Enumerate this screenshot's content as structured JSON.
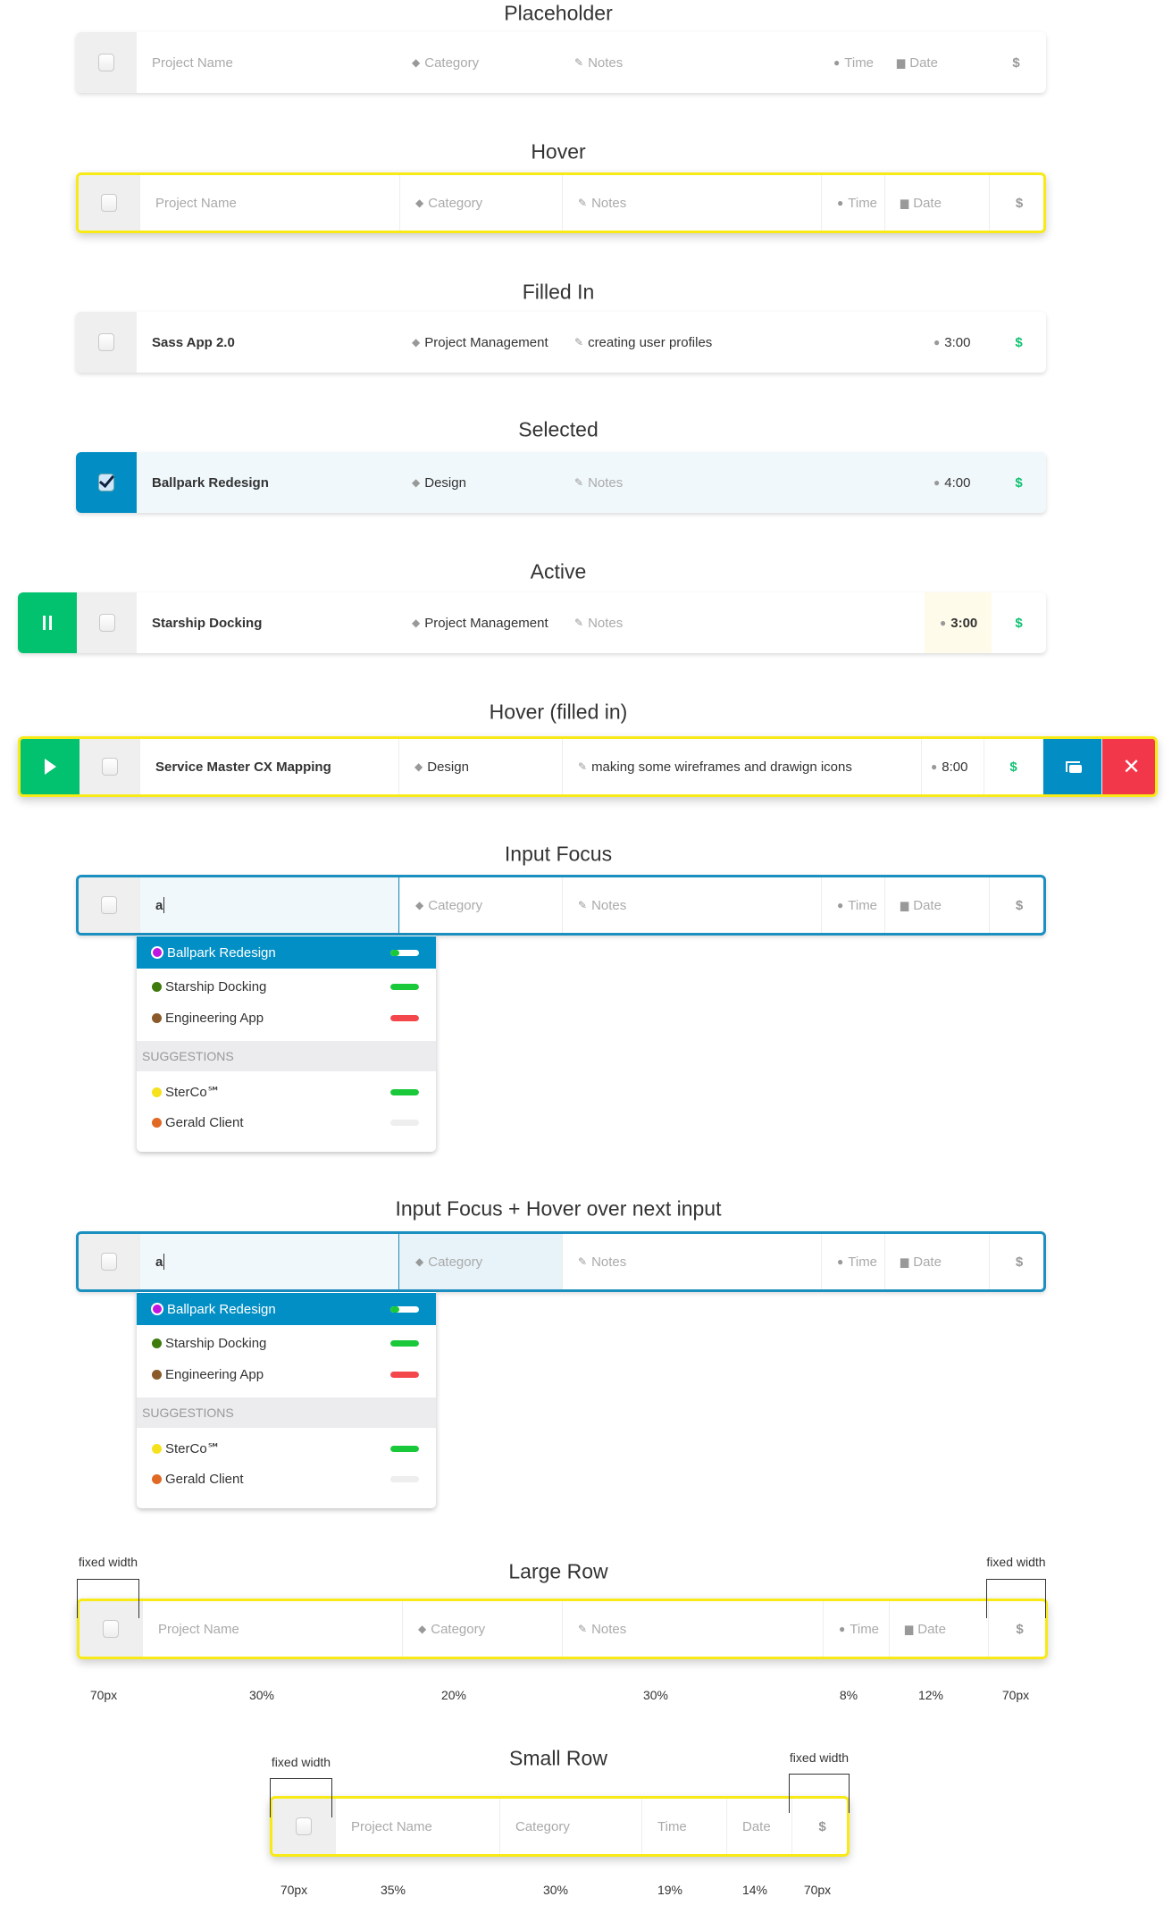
{
  "colors": {
    "accent_blue": "#028ec4",
    "play_green": "#02c16f",
    "delete_red": "#f3374b",
    "hover_yellow": "#f7ea17",
    "money_green": "#12c172"
  },
  "sections": [
    {
      "title": "Placeholder",
      "cells": [
        {
          "kind": "checkbox"
        },
        {
          "kind": "name",
          "text": "Project Name",
          "ph": true
        },
        {
          "kind": "category",
          "text": "Category",
          "ph": true
        },
        {
          "kind": "notes",
          "text": "Notes",
          "ph": true
        },
        {
          "kind": "time",
          "text": "Time",
          "ph": true
        },
        {
          "kind": "date",
          "text": "Date",
          "ph": true
        },
        {
          "kind": "money",
          "text": "$",
          "ph": true
        }
      ]
    },
    {
      "title": "Hover",
      "cells": [
        {
          "kind": "checkbox"
        },
        {
          "kind": "name",
          "text": "Project Name",
          "ph": true
        },
        {
          "kind": "category",
          "text": "Category",
          "ph": true
        },
        {
          "kind": "notes",
          "text": "Notes",
          "ph": true
        },
        {
          "kind": "time",
          "text": "Time",
          "ph": true
        },
        {
          "kind": "date",
          "text": "Date",
          "ph": true
        },
        {
          "kind": "money",
          "text": "$",
          "ph": true
        }
      ]
    },
    {
      "title": "Filled In",
      "cells": [
        {
          "kind": "checkbox"
        },
        {
          "kind": "name",
          "text": "Sass App 2.0"
        },
        {
          "kind": "category",
          "text": "Project Management"
        },
        {
          "kind": "notes",
          "text": "creating user profiles"
        },
        {
          "kind": "time",
          "text": "3:00"
        },
        {
          "kind": "money",
          "text": "$"
        }
      ]
    },
    {
      "title": "Selected",
      "cells": [
        {
          "kind": "checkbox",
          "checked": true
        },
        {
          "kind": "name",
          "text": "Ballpark Redesign"
        },
        {
          "kind": "category",
          "text": "Design"
        },
        {
          "kind": "notes",
          "text": "Notes",
          "ph": true
        },
        {
          "kind": "time",
          "text": "4:00"
        },
        {
          "kind": "money",
          "text": "$"
        }
      ]
    },
    {
      "title": "Active",
      "cells": [
        {
          "kind": "pause"
        },
        {
          "kind": "checkbox"
        },
        {
          "kind": "name",
          "text": "Starship Docking"
        },
        {
          "kind": "category",
          "text": "Project Management"
        },
        {
          "kind": "notes",
          "text": "Notes",
          "ph": true
        },
        {
          "kind": "time",
          "text": "3:00",
          "highlight": true
        },
        {
          "kind": "money",
          "text": "$"
        }
      ]
    },
    {
      "title": "Hover (filled in)",
      "cells": [
        {
          "kind": "play"
        },
        {
          "kind": "checkbox"
        },
        {
          "kind": "name",
          "text": "Service Master CX Mapping"
        },
        {
          "kind": "category",
          "text": "Design"
        },
        {
          "kind": "notes",
          "text": "making some wireframes and drawign icons"
        },
        {
          "kind": "time",
          "text": "8:00"
        },
        {
          "kind": "money",
          "text": "$"
        },
        {
          "kind": "copy"
        },
        {
          "kind": "delete"
        }
      ]
    },
    {
      "title": "Input Focus",
      "cells": [
        {
          "kind": "checkbox"
        },
        {
          "kind": "name",
          "text": "a",
          "input": true
        },
        {
          "kind": "category",
          "text": "Category",
          "ph": true
        },
        {
          "kind": "notes",
          "text": "Notes",
          "ph": true
        },
        {
          "kind": "time",
          "text": "Time",
          "ph": true
        },
        {
          "kind": "date",
          "text": "Date",
          "ph": true
        },
        {
          "kind": "money",
          "text": "$",
          "ph": true
        }
      ]
    },
    {
      "title": "Input Focus + Hover over next input",
      "cells": [
        {
          "kind": "checkbox"
        },
        {
          "kind": "name",
          "text": "a",
          "input": true
        },
        {
          "kind": "category",
          "text": "Category",
          "ph": true,
          "hover": true
        },
        {
          "kind": "notes",
          "text": "Notes",
          "ph": true
        },
        {
          "kind": "time",
          "text": "Time",
          "ph": true
        },
        {
          "kind": "date",
          "text": "Date",
          "ph": true
        },
        {
          "kind": "money",
          "text": "$",
          "ph": true
        }
      ]
    },
    {
      "title": "Large Row",
      "cells": [
        {
          "kind": "checkbox"
        },
        {
          "kind": "name",
          "text": "Project Name",
          "ph": true
        },
        {
          "kind": "category",
          "text": "Category",
          "ph": true
        },
        {
          "kind": "notes",
          "text": "Notes",
          "ph": true
        },
        {
          "kind": "time",
          "text": "Time",
          "ph": true
        },
        {
          "kind": "date",
          "text": "Date",
          "ph": true
        },
        {
          "kind": "money",
          "text": "$",
          "ph": true
        }
      ],
      "fixed_label": "fixed width",
      "widths": [
        "70px",
        "30%",
        "20%",
        "30%",
        "8%",
        "12%",
        "70px"
      ]
    },
    {
      "title": "Small Row",
      "cells": [
        {
          "kind": "checkbox"
        },
        {
          "kind": "name",
          "text": "Project Name",
          "ph": true
        },
        {
          "kind": "category",
          "text": "Category",
          "ph": true,
          "noicon": true
        },
        {
          "kind": "time",
          "text": "Time",
          "ph": true,
          "noicon": true
        },
        {
          "kind": "date",
          "text": "Date",
          "ph": true,
          "noicon": true
        },
        {
          "kind": "money",
          "text": "$",
          "ph": true
        }
      ],
      "fixed_label": "fixed width",
      "widths": [
        "70px",
        "35%",
        "30%",
        "19%",
        "14%",
        "70px"
      ]
    }
  ],
  "dropdown": {
    "items": [
      {
        "label": "Ballpark Redesign",
        "dot": "#c015e0",
        "progress": 0.3,
        "bar": "#19c93a",
        "active": true
      },
      {
        "label": "Starship Docking",
        "dot": "#3f7a0d",
        "progress": 1,
        "bar": "#19c93a"
      },
      {
        "label": "Engineering App",
        "dot": "#8a5a2b",
        "progress": 1,
        "bar": "#f4474b"
      }
    ],
    "suggestions_header": "SUGGESTIONS",
    "suggestions": [
      {
        "label": "SterCo℠",
        "dot": "#f5e11c",
        "progress": 1,
        "bar": "#19c93a"
      },
      {
        "label": "Gerald Client",
        "dot": "#e06a25",
        "progress": 0,
        "bar": "#19c93a"
      }
    ]
  }
}
